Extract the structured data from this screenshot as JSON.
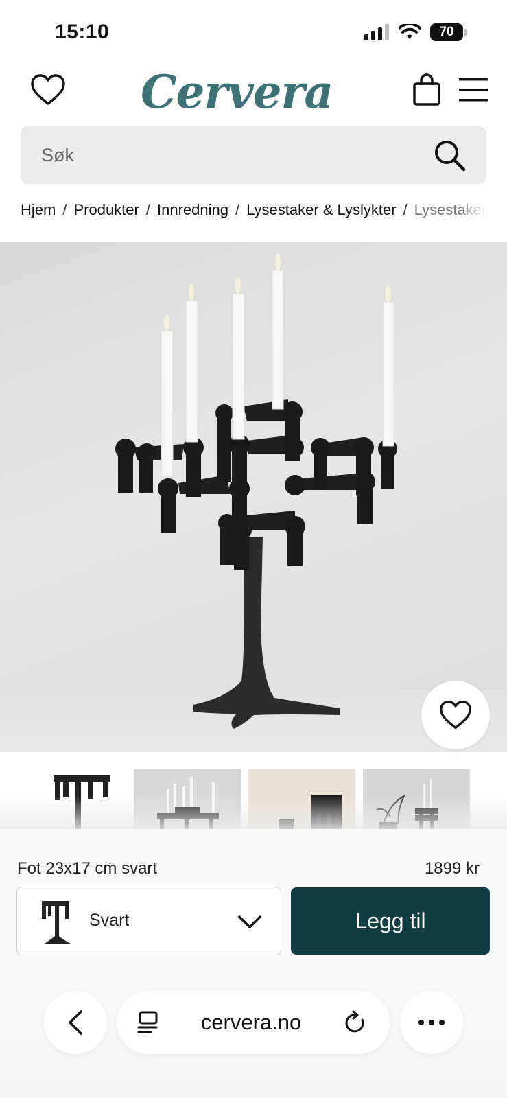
{
  "status_bar": {
    "time": "15:10",
    "battery": "70"
  },
  "header": {
    "logo": "Cervera"
  },
  "search": {
    "placeholder": "Søk"
  },
  "breadcrumb": {
    "items": [
      "Hjem",
      "Produkter",
      "Innredning",
      "Lysestaker & Lyslykter"
    ],
    "current": "Lysestaker"
  },
  "product": {
    "variant_title": "Fot 23x17 cm svart",
    "price": "1899 kr",
    "selected_variant": "Svart",
    "add_button": "Legg til"
  },
  "browser": {
    "url": "cervera.no"
  },
  "colors": {
    "brand": "#3d7278",
    "button": "#113e44"
  }
}
